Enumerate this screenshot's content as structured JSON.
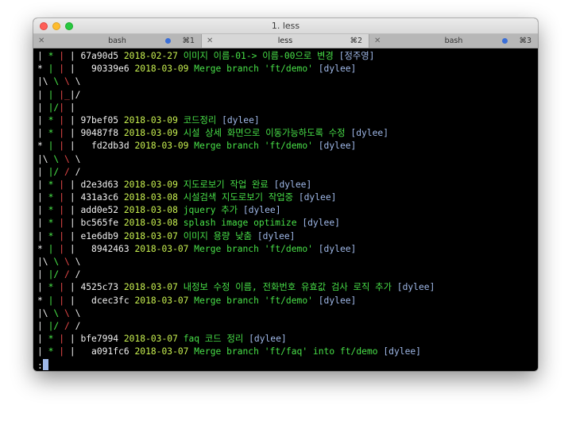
{
  "window": {
    "title": "1. less"
  },
  "tabs": [
    {
      "label": "bash",
      "shortcut": "⌘1",
      "active": false
    },
    {
      "label": "less",
      "shortcut": "⌘2",
      "active": true
    },
    {
      "label": "bash",
      "shortcut": "⌘3",
      "active": false
    }
  ],
  "colors": {
    "graph_white": "#f2f2f2",
    "graph_green": "#4cf04c",
    "graph_red": "#e84848",
    "date": "#c8f050",
    "message": "#48e048",
    "author": "#9fb8e8"
  },
  "log": [
    {
      "graph": [
        "| ",
        "* ",
        "| ",
        "| "
      ],
      "hash": "67a90d5",
      "date": "2018-02-27",
      "message": "이미지 이름-01-> 이름-00으로 변경",
      "author": "[정주영]"
    },
    {
      "graph": [
        "* ",
        "| ",
        "| ",
        "| "
      ],
      "hash": "  90339e6",
      "date": "2018-03-09",
      "message": "Merge branch 'ft/demo'",
      "author": "[dylee]"
    },
    {
      "graph": [
        "|\\ ",
        "\\ ",
        "\\ ",
        "\\"
      ],
      "hash": "",
      "date": "",
      "message": "",
      "author": ""
    },
    {
      "graph": [
        "| ",
        "| ",
        "|_",
        "|/"
      ],
      "hash": "",
      "date": "",
      "message": "",
      "author": ""
    },
    {
      "graph": [
        "| ",
        "|/",
        "| ",
        "|"
      ],
      "hash": "",
      "date": "",
      "message": "",
      "author": ""
    },
    {
      "graph": [
        "| ",
        "* ",
        "| ",
        "| "
      ],
      "hash": "97bef05",
      "date": "2018-03-09",
      "message": "코드정리",
      "author": "[dylee]"
    },
    {
      "graph": [
        "| ",
        "* ",
        "| ",
        "| "
      ],
      "hash": "90487f8",
      "date": "2018-03-09",
      "message": "시설 상세 화면으로 이동가능하도록 수정",
      "author": "[dylee]"
    },
    {
      "graph": [
        "* ",
        "| ",
        "| ",
        "| "
      ],
      "hash": "  fd2db3d",
      "date": "2018-03-09",
      "message": "Merge branch 'ft/demo'",
      "author": "[dylee]"
    },
    {
      "graph": [
        "|\\ ",
        "\\ ",
        "\\ ",
        "\\"
      ],
      "hash": "",
      "date": "",
      "message": "",
      "author": ""
    },
    {
      "graph": [
        "| ",
        "|/",
        " / ",
        "/"
      ],
      "hash": "",
      "date": "",
      "message": "",
      "author": ""
    },
    {
      "graph": [
        "| ",
        "* ",
        "| ",
        "| "
      ],
      "hash": "d2e3d63",
      "date": "2018-03-09",
      "message": "지도로보기 작업 완료",
      "author": "[dylee]"
    },
    {
      "graph": [
        "| ",
        "* ",
        "| ",
        "| "
      ],
      "hash": "431a3c6",
      "date": "2018-03-08",
      "message": "시설검색 지도로보기 작업중",
      "author": "[dylee]"
    },
    {
      "graph": [
        "| ",
        "* ",
        "| ",
        "| "
      ],
      "hash": "add0e52",
      "date": "2018-03-08",
      "message": "jquery 추가",
      "author": "[dylee]"
    },
    {
      "graph": [
        "| ",
        "* ",
        "| ",
        "| "
      ],
      "hash": "bc565fe",
      "date": "2018-03-08",
      "message": "splash image optimize",
      "author": "[dylee]"
    },
    {
      "graph": [
        "| ",
        "* ",
        "| ",
        "| "
      ],
      "hash": "e1e6db9",
      "date": "2018-03-07",
      "message": "이미지 용량 낮춤",
      "author": "[dylee]"
    },
    {
      "graph": [
        "* ",
        "| ",
        "| ",
        "| "
      ],
      "hash": "  8942463",
      "date": "2018-03-07",
      "message": "Merge branch 'ft/demo'",
      "author": "[dylee]"
    },
    {
      "graph": [
        "|\\ ",
        "\\ ",
        "\\ ",
        "\\"
      ],
      "hash": "",
      "date": "",
      "message": "",
      "author": ""
    },
    {
      "graph": [
        "| ",
        "|/",
        " / ",
        "/"
      ],
      "hash": "",
      "date": "",
      "message": "",
      "author": ""
    },
    {
      "graph": [
        "| ",
        "* ",
        "| ",
        "| "
      ],
      "hash": "4525c73",
      "date": "2018-03-07",
      "message": "내정보 수정 이름, 전화번호 유효값 검사 로직 추가",
      "author": "[dylee]"
    },
    {
      "graph": [
        "* ",
        "| ",
        "| ",
        "| "
      ],
      "hash": "  dcec3fc",
      "date": "2018-03-07",
      "message": "Merge branch 'ft/demo'",
      "author": "[dylee]"
    },
    {
      "graph": [
        "|\\ ",
        "\\ ",
        "\\ ",
        "\\"
      ],
      "hash": "",
      "date": "",
      "message": "",
      "author": ""
    },
    {
      "graph": [
        "| ",
        "|/",
        " / ",
        "/"
      ],
      "hash": "",
      "date": "",
      "message": "",
      "author": ""
    },
    {
      "graph": [
        "| ",
        "* ",
        "| ",
        "| "
      ],
      "hash": "bfe7994",
      "date": "2018-03-07",
      "message": "faq 코드 정리",
      "author": "[dylee]"
    },
    {
      "graph": [
        "| ",
        "* ",
        "| ",
        "| "
      ],
      "hash": "  a091fc6",
      "date": "2018-03-07",
      "message": "Merge branch 'ft/faq' into ft/demo",
      "author": "[dylee]"
    }
  ],
  "prompt": ":"
}
